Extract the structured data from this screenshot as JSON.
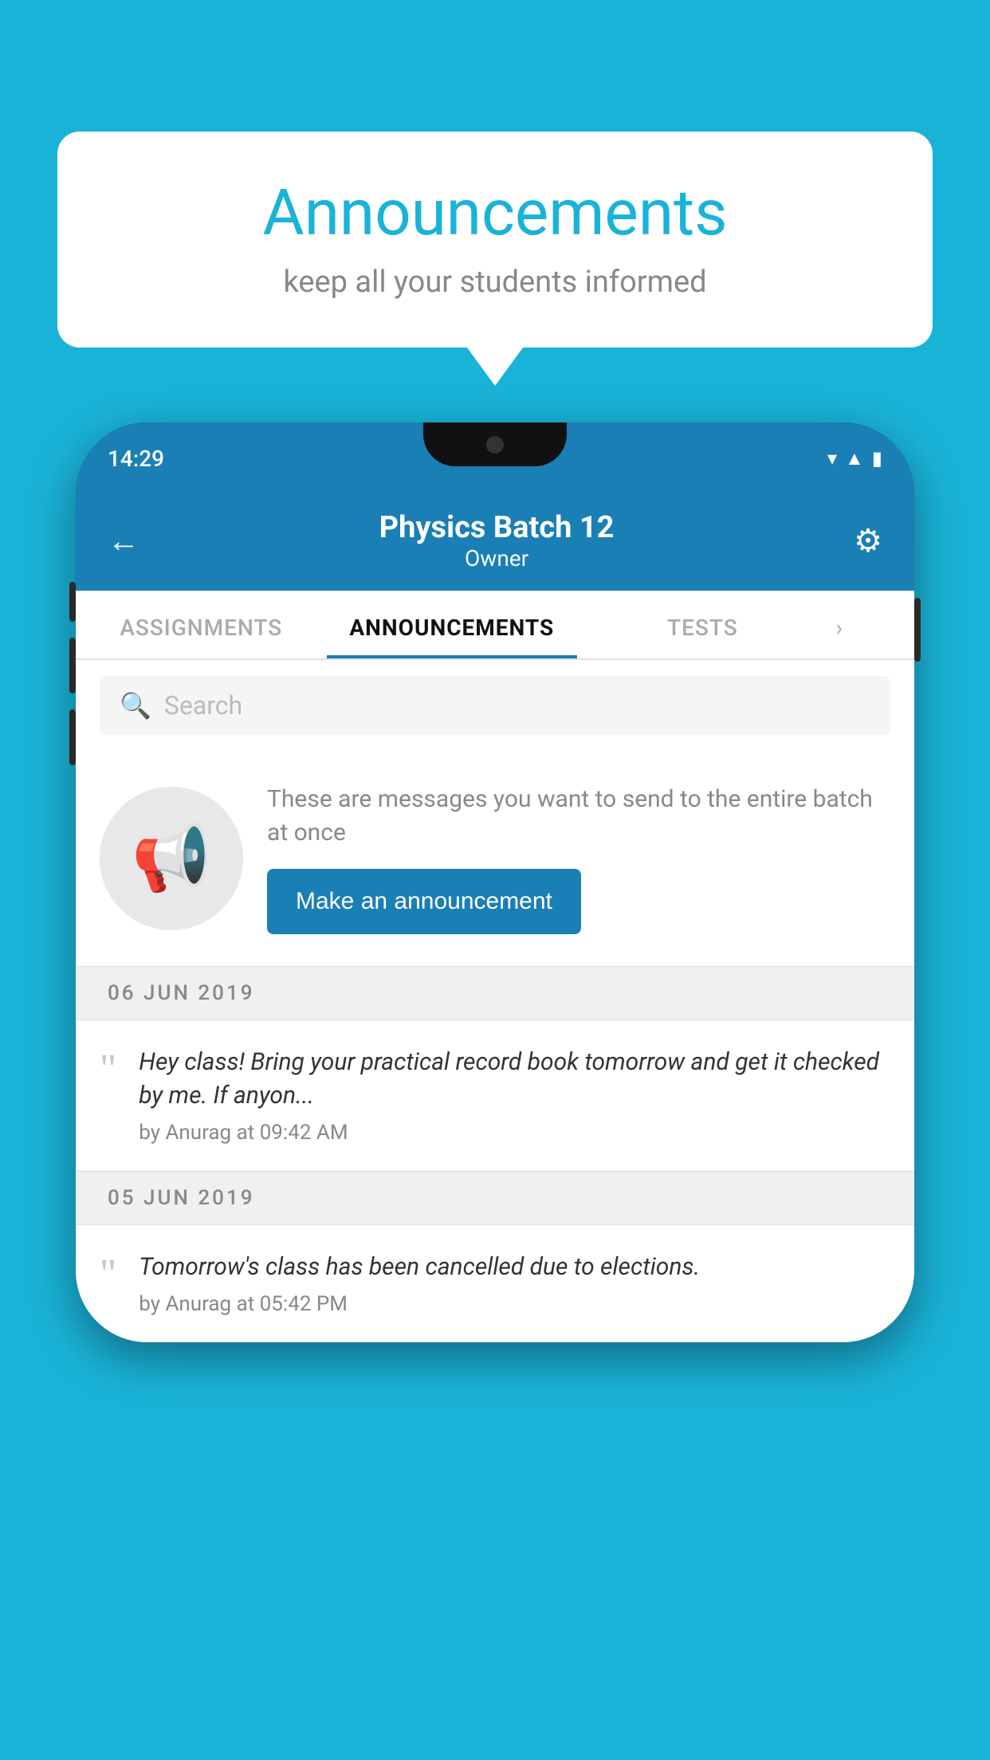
{
  "background_color": "#1ab3d8",
  "speech_bubble": {
    "title": "Announcements",
    "subtitle": "keep all your students informed"
  },
  "phone": {
    "status_bar": {
      "time": "14:29"
    },
    "header": {
      "title": "Physics Batch 12",
      "subtitle": "Owner",
      "back_label": "←"
    },
    "tabs": [
      {
        "label": "ASSIGNMENTS",
        "active": false
      },
      {
        "label": "ANNOUNCEMENTS",
        "active": true
      },
      {
        "label": "TESTS",
        "active": false
      }
    ],
    "search": {
      "placeholder": "Search"
    },
    "announcement_promo": {
      "description": "These are messages you want to send to the entire batch at once",
      "button_label": "Make an announcement"
    },
    "announcement_list": [
      {
        "date": "06  JUN  2019",
        "text": "Hey class! Bring your practical record book tomorrow and get it checked by me. If anyon...",
        "author": "by Anurag at 09:42 AM"
      },
      {
        "date": "05  JUN  2019",
        "text": "Tomorrow's class has been cancelled due to elections.",
        "author": "by Anurag at 05:42 PM"
      }
    ]
  }
}
